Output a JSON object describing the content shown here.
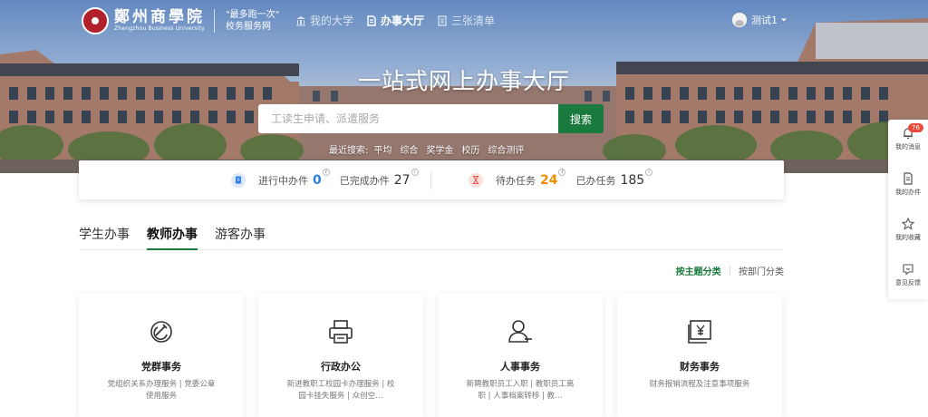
{
  "header": {
    "logo_cn": "鄭州商學院",
    "logo_en": "Zhengzhou Business University",
    "slogan_line1": "\"最多跑一次\"",
    "slogan_line2": "校务服务网",
    "nav": [
      {
        "label": "我的大学",
        "icon": "bank-icon"
      },
      {
        "label": "办事大厅",
        "icon": "document-icon",
        "active": true
      },
      {
        "label": "三张清单",
        "icon": "list-icon"
      }
    ],
    "user_name": "测试1"
  },
  "hero": {
    "title": "一站式网上办事大厅",
    "search_placeholder": "工读生申请、派遣服务",
    "search_button": "搜索",
    "recent_label": "最近搜索:",
    "recent": [
      "平均",
      "综合",
      "奖学金",
      "校历",
      "综合测评"
    ]
  },
  "stats": {
    "in_progress_label": "进行中办件",
    "in_progress": "0",
    "completed_label": "已完成办件",
    "completed": "27",
    "todo_label": "待办任务",
    "todo": "24",
    "done_label": "已办任务",
    "done": "185",
    "info_glyph": "i"
  },
  "tabs": [
    {
      "label": "学生办事"
    },
    {
      "label": "教师办事",
      "active": true
    },
    {
      "label": "游客办事"
    }
  ],
  "sort": {
    "by_theme": "按主题分类",
    "separator": "|",
    "by_dept": "按部门分类"
  },
  "cards": [
    {
      "title": "党群事务",
      "desc": "党组织关系办理服务 | 党委公章使用服务",
      "icon": "hammer-sickle-icon"
    },
    {
      "title": "行政办公",
      "desc": "新进教职工校园卡办理服务 | 校园卡挂失服务 | 众创空…",
      "icon": "printer-icon"
    },
    {
      "title": "人事事务",
      "desc": "新聘教职员工入职 | 教职员工离职 | 人事档案转移 | 教…",
      "icon": "person-icon"
    },
    {
      "title": "财务事务",
      "desc": "财务报销流程及注意事项服务",
      "icon": "yuan-bill-icon"
    }
  ],
  "float": {
    "messages_badge": "76",
    "messages": "我的消息",
    "my_tasks": "我的办件",
    "favorites": "我的收藏",
    "feedback": "意见反馈"
  },
  "colors": {
    "accent_green": "#1a7a3d",
    "todo_orange": "#f08c00",
    "stat_blue": "#2f7de1"
  }
}
